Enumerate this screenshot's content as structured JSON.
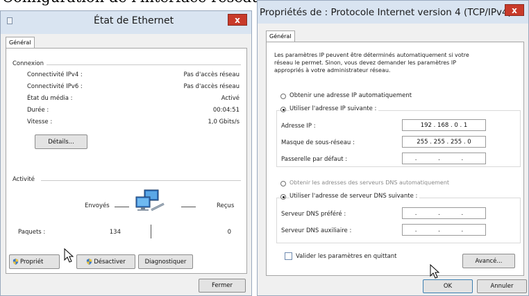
{
  "page_title": "Configuration de l'interface réseau",
  "ethernet_status": {
    "title": "État de Ethernet",
    "close_glyph": "x",
    "tab": "Général",
    "connection_group": "Connexion",
    "rows": [
      {
        "label": "Connectivité IPv4 :",
        "value": "Pas d'accès réseau"
      },
      {
        "label": "Connectivité IPv6 :",
        "value": "Pas d'accès réseau"
      },
      {
        "label": "État du média :",
        "value": "Activé"
      },
      {
        "label": "Durée :",
        "value": "00:04:51"
      },
      {
        "label": "Vitesse :",
        "value": "1,0 Gbits/s"
      }
    ],
    "details_button": "Détails...",
    "activity_group": "Activité",
    "sent_label": "Envoyés",
    "received_label": "Reçus",
    "packets_label": "Paquets :",
    "packets_sent": "134",
    "packets_received": "0",
    "properties_button": "Propriét",
    "disable_button": "Désactiver",
    "diagnose_button": "Diagnostiquer",
    "close_button": "Fermer"
  },
  "ipv4_properties": {
    "title": "Propriétés de : Protocole Internet version 4 (TCP/IPv4)",
    "close_glyph": "x",
    "tab": "Général",
    "description": [
      "Les paramètres IP peuvent être déterminés automatiquement si votre",
      "réseau le permet. Sinon, vous devez demander les paramètres IP",
      "appropriés à votre administrateur réseau."
    ],
    "auto_ip_option": "Obtenir une adresse IP automatiquement",
    "manual_ip_option": "Utiliser l'adresse IP suivante :",
    "ip_label": "Adresse IP :",
    "ip_value": "192 . 168 . 0 . 1",
    "mask_label": "Masque de sous-réseau :",
    "mask_value": "255 . 255 . 255 . 0",
    "gateway_label": "Passerelle par défaut :",
    "gateway_value": ". . .",
    "auto_dns_option": "Obtenir les adresses des serveurs DNS automatiquement",
    "manual_dns_option": "Utiliser l'adresse de serveur DNS suivante :",
    "preferred_dns_label": "Serveur DNS préféré :",
    "preferred_dns_value": ". . .",
    "alternate_dns_label": "Serveur DNS auxiliaire :",
    "alternate_dns_value": ". . .",
    "validate_checkbox": "Valider les paramètres en quittant",
    "advanced_button": "Avancé...",
    "ok_button": "OK",
    "cancel_button": "Annuler"
  },
  "colors": {
    "title_bar": "#d9e4f1",
    "close_button": "#c83a2a",
    "window_body": "#f0f0f0"
  }
}
